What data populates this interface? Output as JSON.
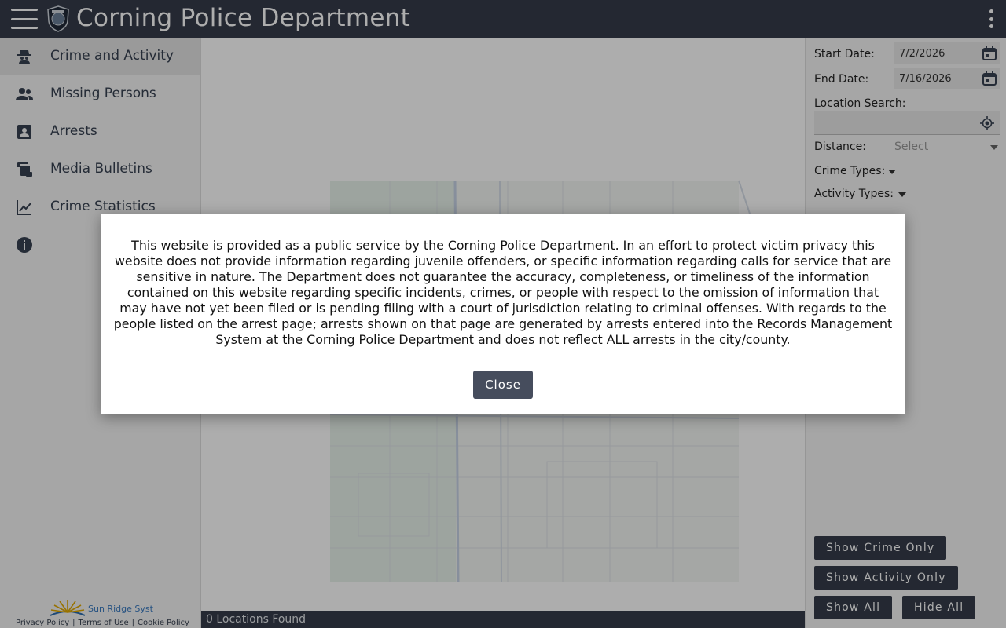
{
  "header": {
    "title": "Corning Police Department",
    "menu_icon": "hamburger-menu-icon",
    "badge_icon": "police-badge-icon",
    "more_icon": "more-vert-icon"
  },
  "sidebar": {
    "items": [
      {
        "label": "Crime and Activity",
        "icon": "detective-icon",
        "active": true
      },
      {
        "label": "Missing Persons",
        "icon": "people-icon"
      },
      {
        "label": "Arrests",
        "icon": "contact-card-icon"
      },
      {
        "label": "Media Bulletins",
        "icon": "bulletin-icon"
      },
      {
        "label": "Crime Statistics",
        "icon": "line-chart-icon"
      },
      {
        "label": "",
        "icon": "info-icon"
      }
    ],
    "footer": {
      "vendor": "Sun Ridge Syst",
      "links": [
        "Privacy Policy",
        "Terms of Use",
        "Cookie Policy"
      ]
    }
  },
  "map": {
    "status": "0 Locations Found"
  },
  "filters": {
    "start_label": "Start Date:",
    "start_value": "7/2/2026",
    "end_label": "End Date:",
    "end_value": "7/16/2026",
    "location_label": "Location Search:",
    "location_value": "",
    "distance_label": "Distance:",
    "distance_placeholder": "Select",
    "crime_types_label": "Crime Types:",
    "activity_types_label": "Activity Types:",
    "buttons": {
      "crime_only": "Show Crime Only",
      "activity_only": "Show Activity Only",
      "show_all": "Show All",
      "hide_all": "Hide All"
    }
  },
  "modal": {
    "text": "This website is provided as a public service by the Corning Police Department. In an effort to protect victim privacy this website does not provide information regarding juvenile offenders, or specific information regarding calls for service that are sensitive in nature. The Department does not guarantee the accuracy, completeness, or timeliness of the information contained on this website regarding specific incidents, crimes, or people with respect to the omission of information that may have not yet been filed or is pending filing with a court of jurisdiction relating to criminal offenses. With regards to the people listed on the arrest page; arrests shown on that page are generated by arrests entered into the Records Management System at the Corning Police Department and does not reflect ALL arrests in the city/county.",
    "close_label": "Close"
  },
  "colors": {
    "header_bg": "#363c4a",
    "button_bg": "#363c4a",
    "link_blue": "#3b7bc0"
  }
}
